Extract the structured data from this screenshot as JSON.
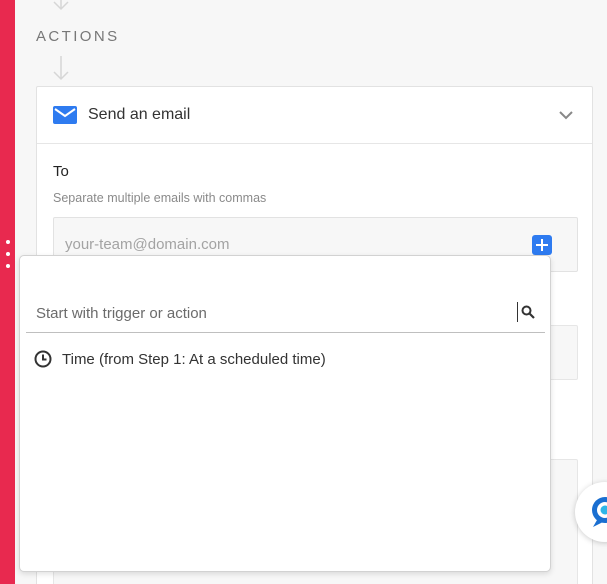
{
  "section": {
    "label": "ACTIONS"
  },
  "action_card": {
    "title": "Send an email",
    "icon": "envelope-icon",
    "accent_color": "#2e7bf0"
  },
  "to_field": {
    "label": "To",
    "help_text": "Separate multiple emails with commas",
    "placeholder": "your-team@domain.com",
    "value": ""
  },
  "dropdown": {
    "search_placeholder": "Start with trigger or action",
    "options": [
      {
        "icon": "clock-icon",
        "label": "Time (from Step 1: At a scheduled time)"
      }
    ]
  },
  "colors": {
    "rail": "#e8294f",
    "primary": "#2e7bf0"
  }
}
